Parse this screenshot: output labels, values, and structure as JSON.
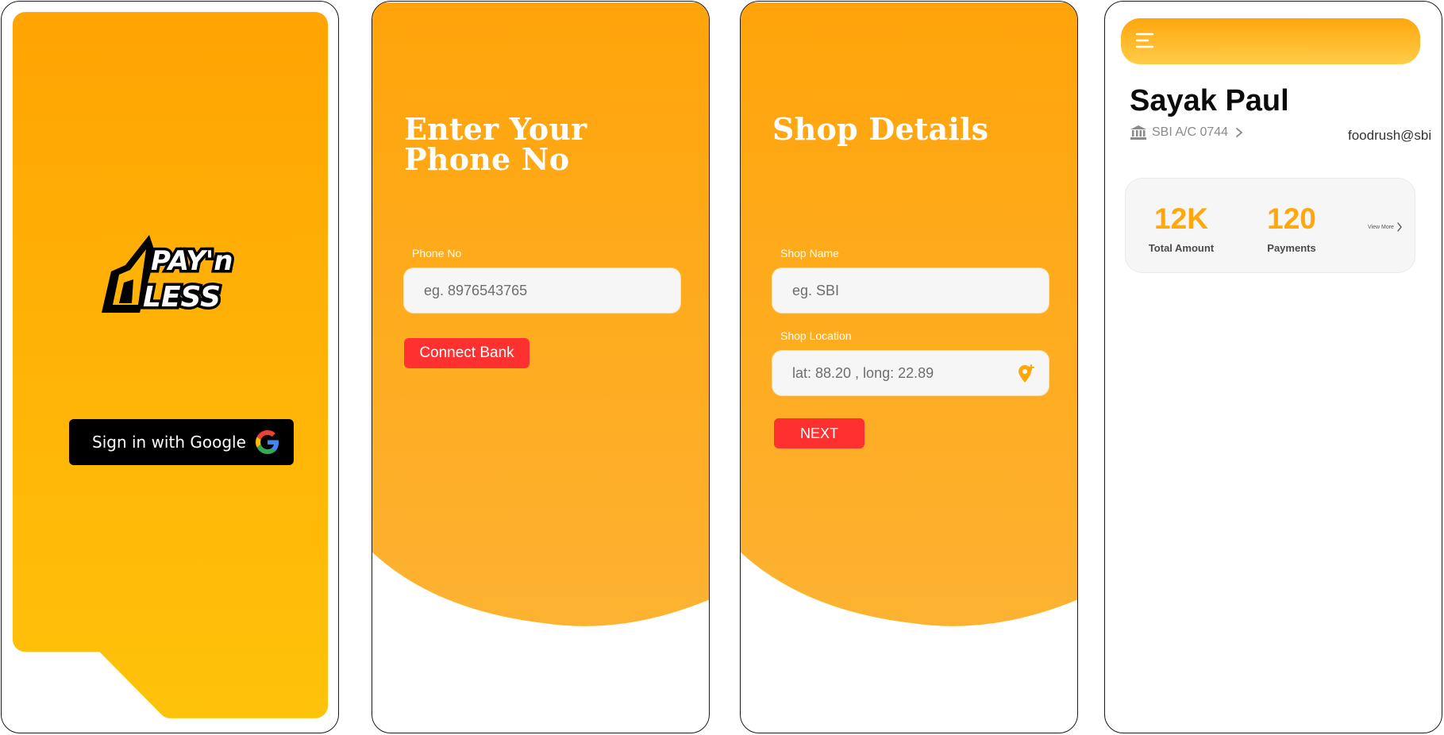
{
  "colors": {
    "brand_orange": "#ffa70d",
    "gradient_end": "#ffc20a",
    "button_red": "#fe3030",
    "google_button": "#000000"
  },
  "login_screen": {
    "logo_text": "PAY'n LESS",
    "google_button_label": "Sign in with Google",
    "google_icon": "google-g-icon"
  },
  "phone_screen": {
    "title_line1": "Enter Your",
    "title_line2": "Phone No",
    "phone_label": "Phone No",
    "phone_placeholder": "eg. 8976543765",
    "connect_button": "Connect Bank"
  },
  "shop_screen": {
    "title": "Shop Details",
    "shop_name_label": "Shop Name",
    "shop_name_placeholder": "eg. SBI",
    "shop_location_label": "Shop Location",
    "shop_location_value": "lat: 88.20 , long: 22.89",
    "location_icon": "map-pin-plus-icon",
    "next_button": "NEXT"
  },
  "dashboard": {
    "menu_icon": "hamburger-menu-icon",
    "user_name": "Sayak Paul",
    "bank_account": "SBI A/C 0744",
    "bank_icon": "bank-icon",
    "upi_id": "foodrush@sbi",
    "stats": [
      {
        "value": "12K",
        "label": "Total Amount"
      },
      {
        "value": "120",
        "label": "Payments"
      }
    ],
    "view_more": "View More"
  }
}
